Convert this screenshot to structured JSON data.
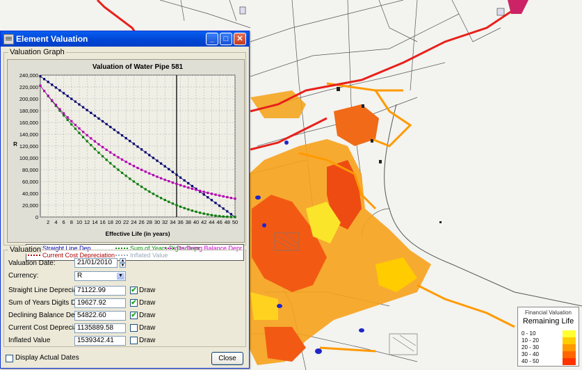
{
  "window": {
    "title": "Element Valuation",
    "buttons": {
      "minimize": "_",
      "maximize": "□",
      "close": "✕"
    }
  },
  "graph": {
    "group_label": "Valuation Graph",
    "legend": [
      {
        "label": "Straight Line Dep.",
        "color": "#0000aa"
      },
      {
        "label": "Sum of Years Digits Depr.",
        "color": "#0a8f0a"
      },
      {
        "label": "Declining Balance Depr.",
        "color": "#cc00cc"
      },
      {
        "label": "Current Cost Depreciation",
        "color": "#b00000"
      },
      {
        "label": "Inflated Value",
        "color": "#9ab"
      }
    ]
  },
  "chart_data": {
    "type": "line",
    "title": "Valuation of Water Pipe 581",
    "xlabel": "Effective Life (in years)",
    "ylabel": "R",
    "xlim": [
      0,
      50
    ],
    "ylim": [
      0,
      240000
    ],
    "xticks": [
      2,
      4,
      6,
      8,
      10,
      12,
      14,
      16,
      18,
      20,
      22,
      24,
      26,
      28,
      30,
      32,
      34,
      36,
      38,
      40,
      42,
      44,
      46,
      48,
      50
    ],
    "yticks": [
      0,
      20000,
      40000,
      60000,
      80000,
      100000,
      120000,
      140000,
      160000,
      180000,
      200000,
      220000,
      240000
    ],
    "ytick_labels": [
      "0",
      "20,000",
      "40,000",
      "60,000",
      "80,000",
      "100,000",
      "120,000",
      "140,000",
      "160,000",
      "180,000",
      "200,000",
      "220,000",
      "240,000"
    ],
    "marker_x": 35,
    "grid": true,
    "series": [
      {
        "name": "Straight Line Dep.",
        "color": "#00006e",
        "model": "linear",
        "start": 238000,
        "end": 0
      },
      {
        "name": "Sum of Years Digits Depr.",
        "color": "#0a7a0a",
        "model": "syd",
        "start": 222000,
        "end": 0
      },
      {
        "name": "Declining Balance Depr.",
        "color": "#b000b0",
        "model": "decline",
        "start": 222000,
        "end": 31000
      }
    ]
  },
  "valuation": {
    "group_label": "Valuation",
    "date_label": "Valuation Date:",
    "date_value": "21/01/2010",
    "currency_label": "Currency:",
    "currency_value": "R",
    "draw_label": "Draw",
    "rows": [
      {
        "label": "Straight Line Depreciation:",
        "value": "71122.99",
        "draw": true
      },
      {
        "label": "Sum of Years Digits Depreciation:",
        "value": "19627.92",
        "draw": true
      },
      {
        "label": "Declining Balance Depreciation:",
        "value": "54822.60",
        "draw": true
      },
      {
        "label": "Current Cost Depreciation:",
        "value": "1135889.58",
        "draw": false
      },
      {
        "label": "Inflated Value",
        "value": "1539342.41",
        "draw": false
      }
    ]
  },
  "footer": {
    "display_actual_dates": "Display Actual Dates",
    "close_button": "Close"
  },
  "map_legend": {
    "title": "Financial Valuation",
    "subtitle": "Remaining Life",
    "classes": [
      {
        "label": "0 - 10",
        "color": "#ffff33"
      },
      {
        "label": "10 - 20",
        "color": "#ffcc00"
      },
      {
        "label": "20 - 30",
        "color": "#ff9900"
      },
      {
        "label": "30 - 40",
        "color": "#ff6600"
      },
      {
        "label": "40 - 50",
        "color": "#ff3300"
      }
    ]
  }
}
